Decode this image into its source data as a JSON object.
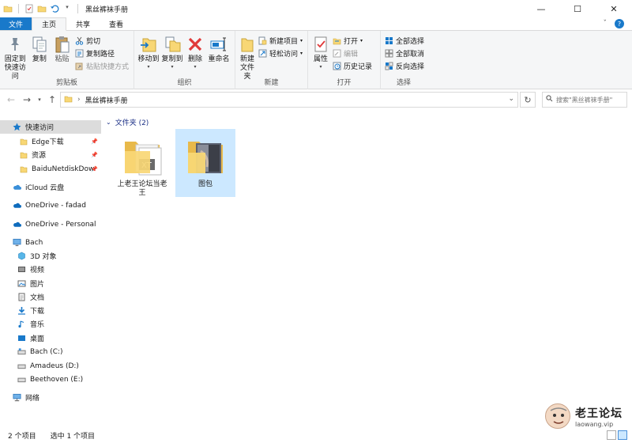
{
  "window": {
    "title": "黑丝裤袜手册"
  },
  "tabs": {
    "file": "文件",
    "home": "主页",
    "share": "共享",
    "view": "查看"
  },
  "ribbon": {
    "clipboard": {
      "label": "剪贴板",
      "pin_line1": "固定到",
      "pin_line2": "快速访问",
      "copy": "复制",
      "paste": "粘贴",
      "cut": "剪切",
      "copy_path": "复制路径",
      "paste_shortcut": "粘贴快捷方式"
    },
    "organize": {
      "label": "组织",
      "move_to": "移动到",
      "copy_to": "复制到",
      "delete": "删除",
      "rename": "重命名"
    },
    "new": {
      "label": "新建",
      "new_folder_line1": "新建",
      "new_folder_line2": "文件夹",
      "new_item": "新建项目",
      "easy_access": "轻松访问"
    },
    "open": {
      "label": "打开",
      "properties": "属性",
      "open": "打开",
      "edit": "编辑",
      "history": "历史记录"
    },
    "select": {
      "label": "选择",
      "select_all": "全部选择",
      "select_none": "全部取消",
      "invert": "反向选择"
    }
  },
  "address": {
    "crumb": "黑丝裤袜手册",
    "search_placeholder": "搜索\"黑丝裤袜手册\""
  },
  "nav": {
    "quick_access": "快速访问",
    "pinned": [
      {
        "label": "Edge下载"
      },
      {
        "label": "资源"
      },
      {
        "label": "BaiduNetdiskDowr"
      }
    ],
    "icloud": "iCloud 云盘",
    "onedrive1": "OneDrive - fadad",
    "onedrive2": "OneDrive - Personal",
    "pc": "Bach",
    "pc_items": [
      {
        "label": "3D 对象"
      },
      {
        "label": "视频"
      },
      {
        "label": "图片"
      },
      {
        "label": "文档"
      },
      {
        "label": "下载"
      },
      {
        "label": "音乐"
      },
      {
        "label": "桌面"
      },
      {
        "label": "Bach (C:)"
      },
      {
        "label": "Amadeus (D:)"
      },
      {
        "label": "Beethoven (E:)"
      }
    ],
    "network": "网络"
  },
  "content": {
    "group_header": "文件夹 (2)",
    "items": [
      {
        "name": "上老王论坛当老王",
        "selected": false
      },
      {
        "name": "图包",
        "selected": true
      }
    ]
  },
  "status": {
    "count": "2 个项目",
    "selection": "选中 1 个项目"
  },
  "watermark": {
    "title": "老王论坛",
    "url": "laowang.vip"
  },
  "colors": {
    "accent": "#1979ca",
    "selection": "#cce8ff",
    "folder": "#f8d775"
  }
}
